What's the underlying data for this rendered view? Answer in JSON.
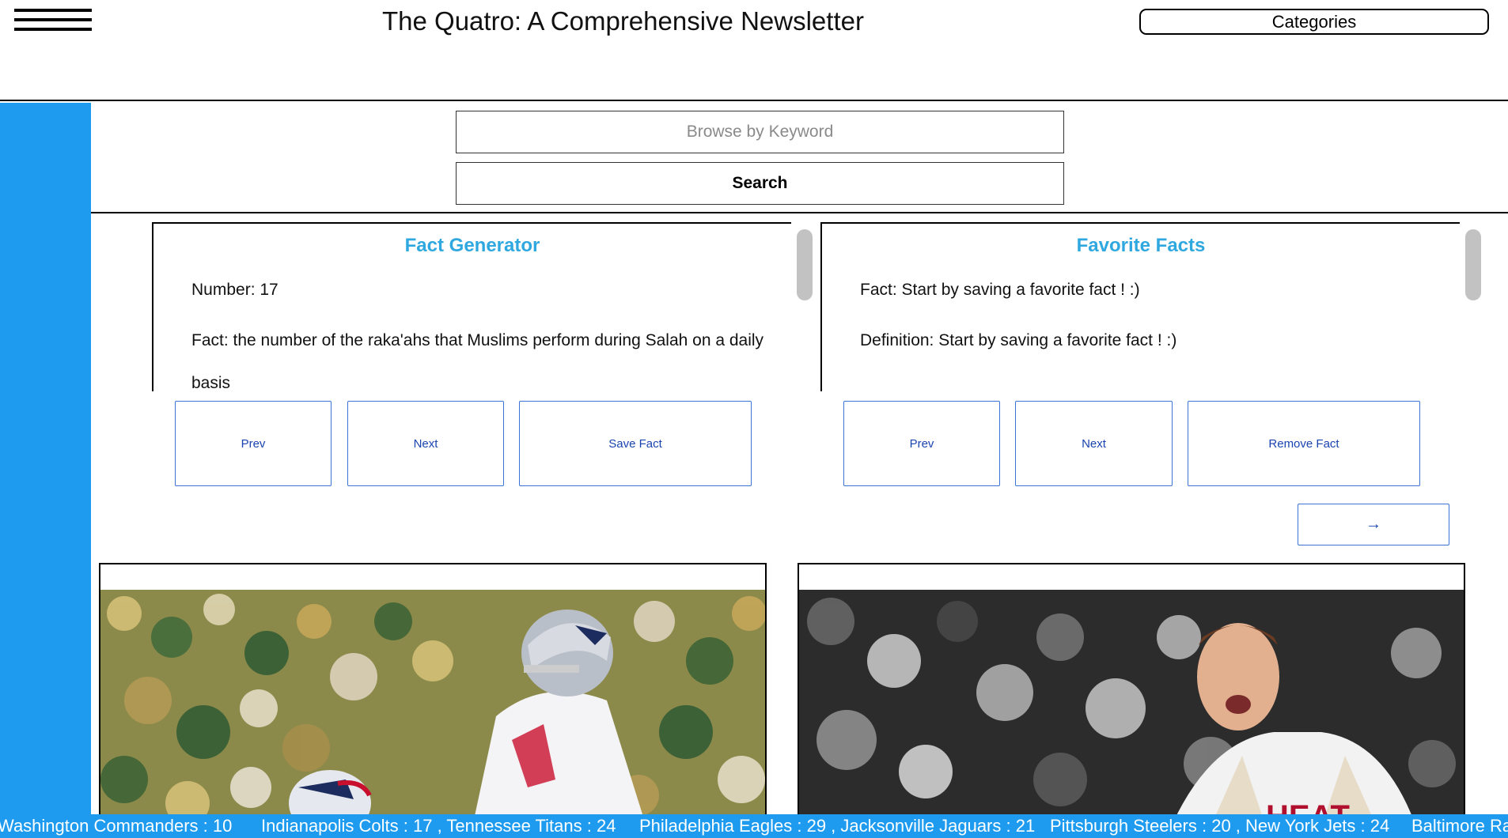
{
  "header": {
    "title": "The Quatro: A Comprehensive Newsletter",
    "categories_label": "Categories"
  },
  "search": {
    "placeholder": "Browse by Keyword",
    "value": "",
    "button_label": "Search"
  },
  "fact_generator": {
    "title": "Fact Generator",
    "number_line": "Number: 17",
    "fact_line_1": "Fact: the number of the raka'ahs that Muslims perform during Salah on a daily",
    "fact_line_2": "basis",
    "buttons": {
      "prev": "Prev",
      "next": "Next",
      "save": "Save Fact"
    }
  },
  "favorite_facts": {
    "title": "Favorite Facts",
    "fact_line": "Fact: Start by saving a favorite fact ! :)",
    "definition_line": "Definition: Start by saving a favorite fact ! :)",
    "buttons": {
      "prev": "Prev",
      "next": "Next",
      "remove": "Remove Fact"
    }
  },
  "pager": {
    "arrow": "→"
  },
  "ticker": {
    "items": [
      "Washington Commanders : 10",
      "Indianapolis Colts : 17 , Tennessee Titans : 24",
      "Philadelphia Eagles : 29 , Jacksonville Jaguars : 21",
      "Pittsburgh Steelers : 20 , New York Jets : 24",
      "Baltimore Ra"
    ]
  },
  "colors": {
    "sidebar": "#1e9bef",
    "panel_title": "#2fa8e0",
    "button_border": "#3b73d6",
    "button_text": "#1a44b0"
  }
}
